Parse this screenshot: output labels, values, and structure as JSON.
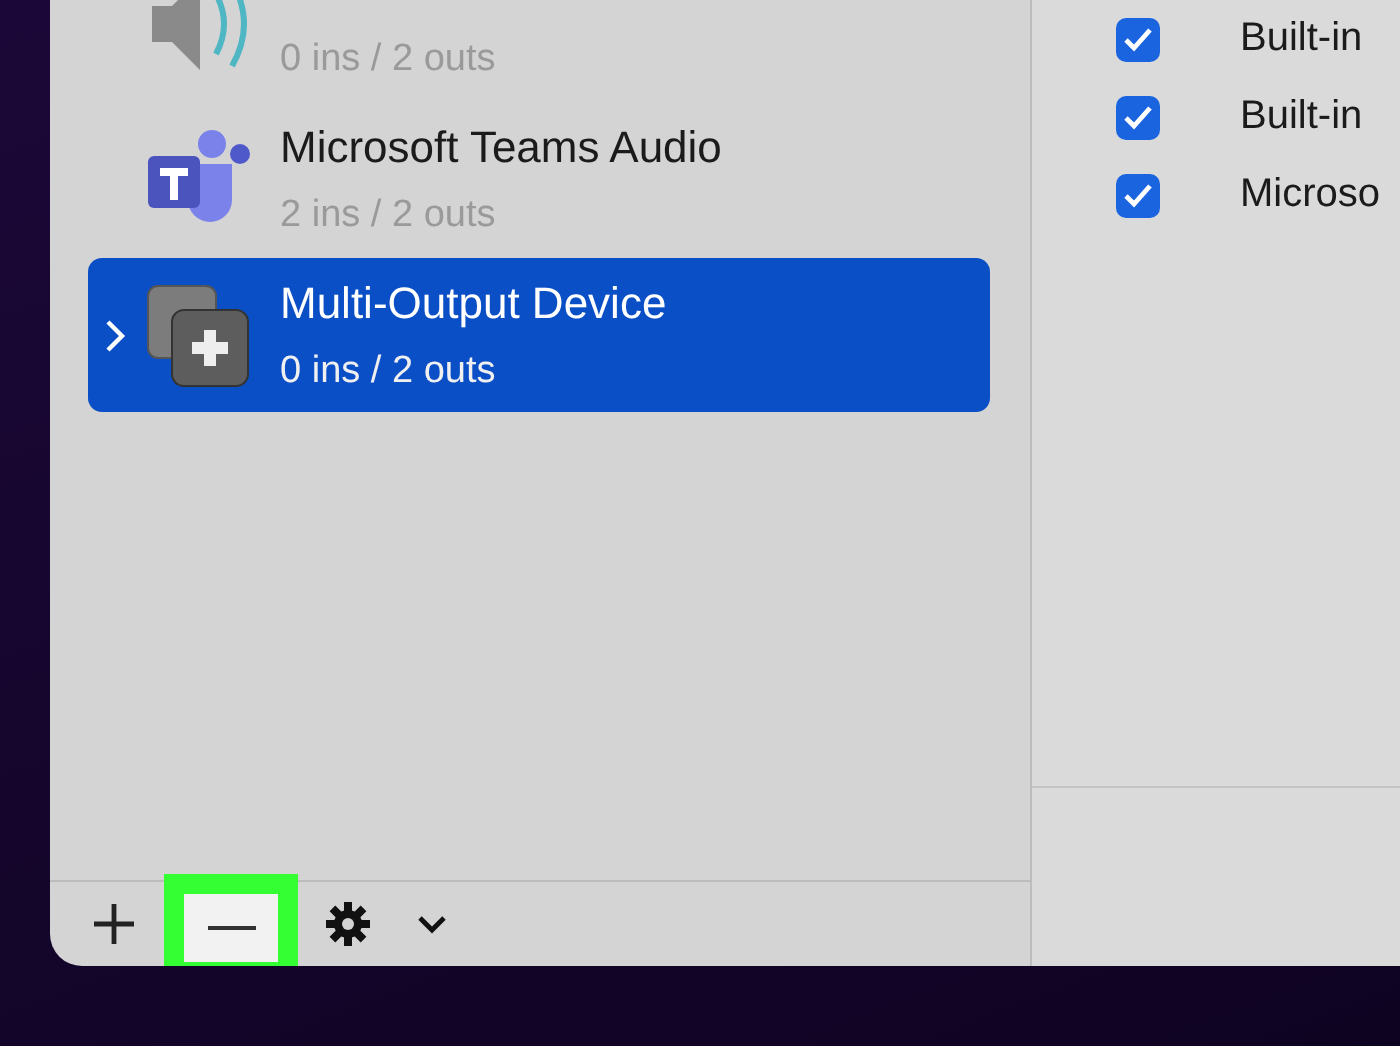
{
  "devices": [
    {
      "kind": "speaker",
      "io": "0 ins / 2 outs",
      "selected": false,
      "expandable": false
    },
    {
      "kind": "teams",
      "name": "Microsoft Teams Audio",
      "io": "2 ins / 2 outs",
      "selected": false,
      "expandable": false
    },
    {
      "kind": "multi-output",
      "name": "Multi-Output Device",
      "io": "0 ins / 2 outs",
      "selected": true,
      "expandable": true
    }
  ],
  "outputs": [
    {
      "label": "Built-in",
      "checked": true
    },
    {
      "label": "Built-in",
      "checked": true
    },
    {
      "label": "Microso",
      "checked": true
    }
  ],
  "toolbar": [
    {
      "kind": "add",
      "highlighted": false
    },
    {
      "kind": "remove",
      "highlighted": true
    },
    {
      "kind": "gear",
      "highlighted": false
    },
    {
      "kind": "menu",
      "highlighted": false
    }
  ]
}
